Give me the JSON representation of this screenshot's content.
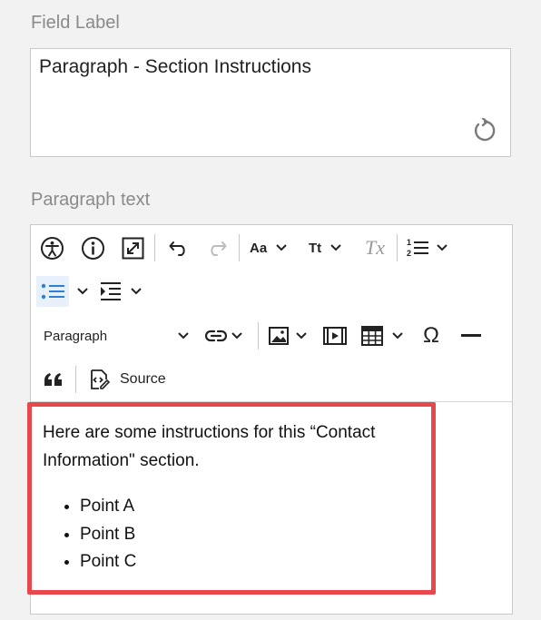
{
  "field_label": {
    "label": "Field Label",
    "value": "Paragraph - Section Instructions",
    "reset_icon": "reset-icon"
  },
  "paragraph_text": {
    "label": "Paragraph text"
  },
  "toolbar": {
    "accessibility_icon": "accessibility-icon",
    "info_icon": "info-icon",
    "fullscreen_icon": "maximize-icon",
    "undo_icon": "undo-icon",
    "redo_icon": "redo-icon",
    "font_size_label": "Aa",
    "text_style_label": "Tt",
    "remove_format_label": "Tx",
    "numbered_list_icon": "numbered-list-icon",
    "bulleted_list_icon": "bulleted-list-icon",
    "indent_icon": "indent-icon",
    "heading_select": "Paragraph",
    "link_icon": "link-icon",
    "image_icon": "image-icon",
    "media_icon": "media-icon",
    "table_icon": "table-icon",
    "special_char_label": "Ω",
    "horizontal_line_icon": "horizontal-line-icon",
    "blockquote_label": "““",
    "source_label": "Source"
  },
  "content": {
    "paragraph": "Here are some instructions for this “Contact Information\" section.",
    "bullets": [
      "Point A",
      "Point B",
      "Point C"
    ]
  },
  "colors": {
    "highlight": "#e8474b",
    "active_button_bg": "#e8f0fb",
    "active_icon": "#2f7fd6"
  }
}
